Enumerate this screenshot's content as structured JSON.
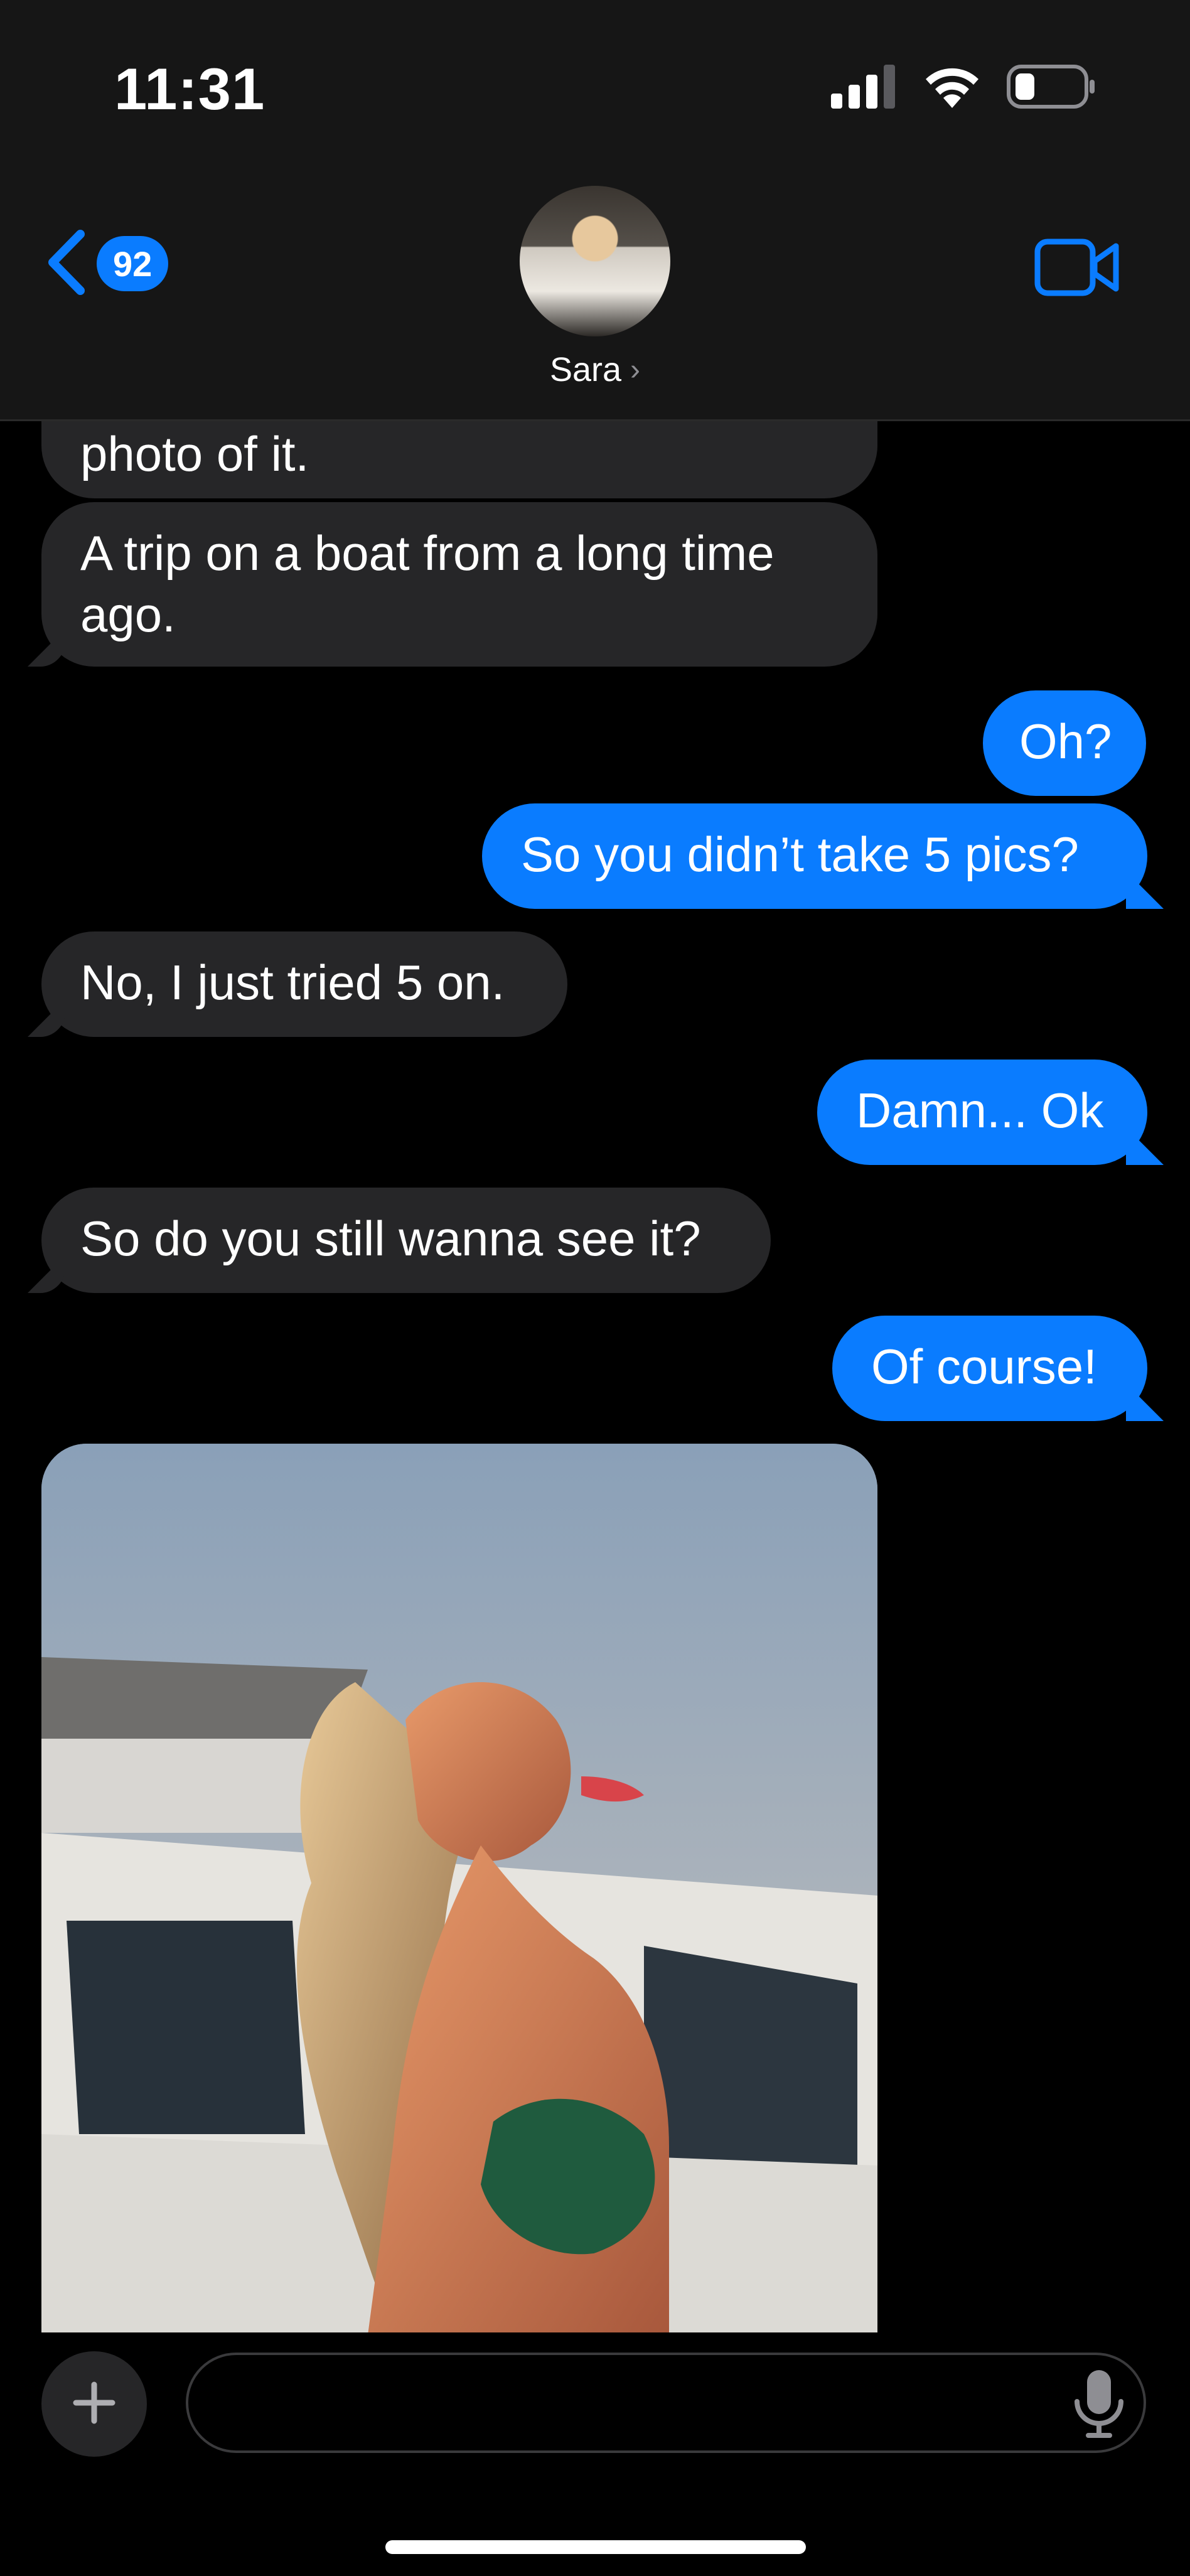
{
  "status_bar": {
    "time": "11:31",
    "signal_icon": "cellular-signal-icon",
    "wifi_icon": "wifi-icon",
    "battery_icon": "battery-low-icon"
  },
  "nav": {
    "back_icon": "chevron-left-icon",
    "unread_count": "92",
    "contact_name": "Sara",
    "video_icon": "video-camera-icon",
    "accent_color": "#0a7cff"
  },
  "messages": [
    {
      "direction": "in",
      "text": "photo of it."
    },
    {
      "direction": "in",
      "text": "A trip on a boat from a long time",
      "text2": "ago."
    },
    {
      "direction": "out",
      "text": "Oh?"
    },
    {
      "direction": "out",
      "text": "So you didn’t take 5 pics?"
    },
    {
      "direction": "in",
      "text": "No, I just tried 5 on."
    },
    {
      "direction": "out",
      "text": "Damn... Ok"
    },
    {
      "direction": "in",
      "text": "So do you still wanna see it?"
    },
    {
      "direction": "out",
      "text": "Of course!"
    },
    {
      "direction": "in",
      "type": "photo"
    }
  ],
  "composer": {
    "plus_icon": "plus-icon",
    "placeholder": "",
    "mic_icon": "microphone-icon"
  },
  "colors": {
    "incoming_bubble": "#262628",
    "outgoing_bubble": "#0a7cff",
    "background": "#000000",
    "header": "#161616"
  }
}
